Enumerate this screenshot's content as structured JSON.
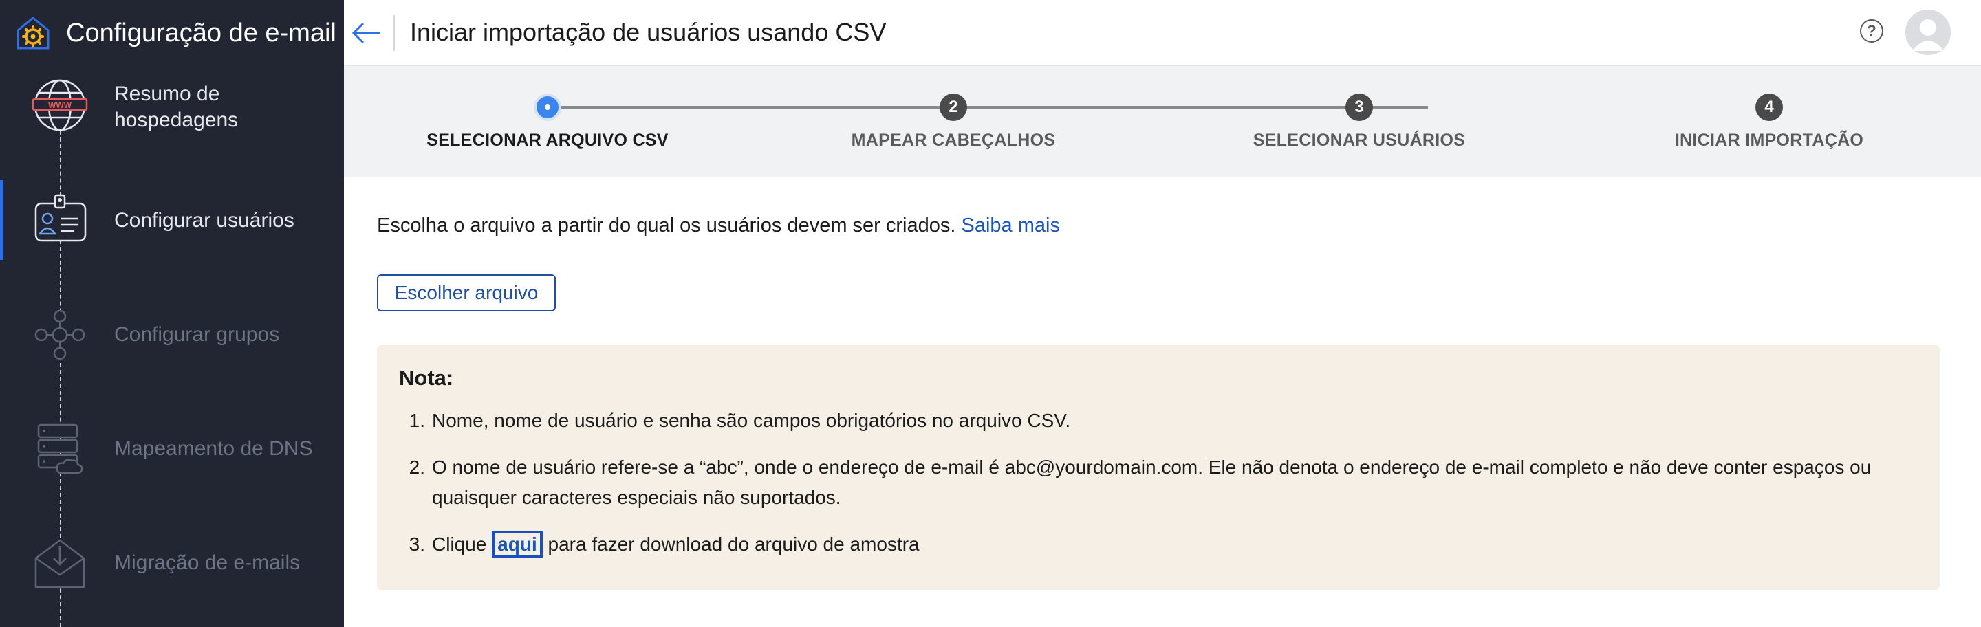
{
  "sidebar": {
    "title": "Configuração de e-mail",
    "items": [
      {
        "label": "Resumo de\nhospedagens",
        "icon": "globe-www-icon",
        "state": "done"
      },
      {
        "label": "Configurar usuários",
        "icon": "user-id-card-icon",
        "state": "active"
      },
      {
        "label": "Configurar grupos",
        "icon": "group-network-icon",
        "state": "pending"
      },
      {
        "label": "Mapeamento de DNS",
        "icon": "dns-server-cloud-icon",
        "state": "pending"
      },
      {
        "label": "Migração de e-mails",
        "icon": "envelope-download-icon",
        "state": "pending"
      }
    ]
  },
  "header": {
    "title": "Iniciar importação de usuários usando CSV",
    "back_icon": "arrow-left-icon",
    "help_icon": "help-circle-icon",
    "help_glyph": "?"
  },
  "stepper": {
    "steps": [
      {
        "number": "",
        "label": "SELECIONAR ARQUIVO CSV",
        "active": true
      },
      {
        "number": "2",
        "label": "MAPEAR CABEÇALHOS",
        "active": false
      },
      {
        "number": "3",
        "label": "SELECIONAR USUÁRIOS",
        "active": false
      },
      {
        "number": "4",
        "label": "INICIAR IMPORTAÇÃO",
        "active": false
      }
    ]
  },
  "content": {
    "intro_text": "Escolha o arquivo a partir do qual os usuários devem ser criados.",
    "learn_more_link": "Saiba mais",
    "choose_file_button": "Escolher arquivo",
    "note": {
      "title": "Nota:",
      "items": [
        {
          "number": "1.",
          "text": "Nome, nome de usuário e senha são campos obrigatórios no arquivo CSV."
        },
        {
          "number": "2.",
          "text": "O nome de usuário refere-se a “abc”, onde o endereço de e-mail é abc@yourdomain.com. Ele não denota o endereço de e-mail completo e não deve conter espaços ou quaisquer caracteres especiais não suportados."
        },
        {
          "number": "3.",
          "prefix": "Clique",
          "link": "aqui",
          "suffix": "para fazer download do arquivo de amostra"
        }
      ]
    }
  },
  "colors": {
    "sidebar_bg": "#222633",
    "accent": "#3d85ee",
    "link": "#1a56b8",
    "note_bg": "#f5efe6",
    "stepper_bg": "#f1f2f4"
  }
}
